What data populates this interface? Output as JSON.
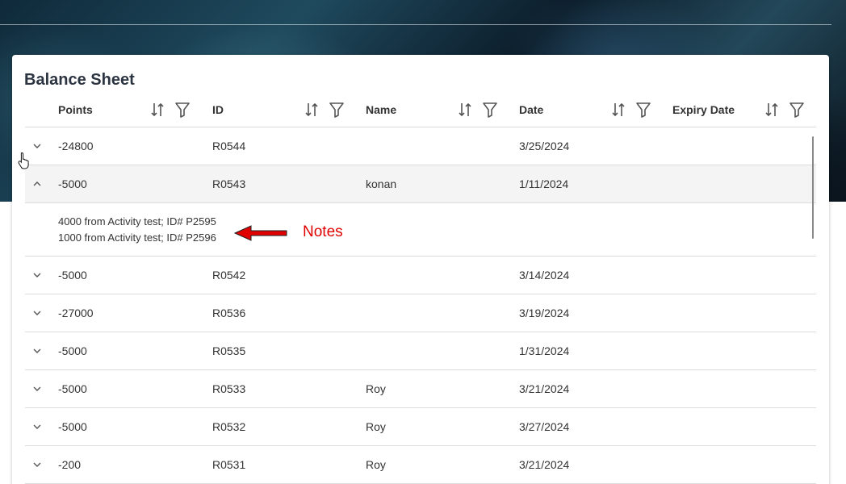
{
  "title": "Balance Sheet",
  "columns": [
    {
      "label": "Points"
    },
    {
      "label": "ID"
    },
    {
      "label": "Name"
    },
    {
      "label": "Date"
    },
    {
      "label": "Expiry Date"
    }
  ],
  "rows": [
    {
      "points": "-24800",
      "id": "R0544",
      "name": "",
      "date": "3/25/2024",
      "expiry": "",
      "expanded": false
    },
    {
      "points": "-5000",
      "id": "R0543",
      "name": "konan",
      "date": "1/11/2024",
      "expiry": "",
      "expanded": true,
      "notes": [
        "4000 from Activity test; ID# P2595",
        "1000 from Activity test; ID# P2596"
      ]
    },
    {
      "points": "-5000",
      "id": "R0542",
      "name": "",
      "date": "3/14/2024",
      "expiry": "",
      "expanded": false
    },
    {
      "points": "-27000",
      "id": "R0536",
      "name": "",
      "date": "3/19/2024",
      "expiry": "",
      "expanded": false
    },
    {
      "points": "-5000",
      "id": "R0535",
      "name": "",
      "date": "1/31/2024",
      "expiry": "",
      "expanded": false
    },
    {
      "points": "-5000",
      "id": "R0533",
      "name": "Roy",
      "date": "3/21/2024",
      "expiry": "",
      "expanded": false
    },
    {
      "points": "-5000",
      "id": "R0532",
      "name": "Roy",
      "date": "3/27/2024",
      "expiry": "",
      "expanded": false
    },
    {
      "points": "-200",
      "id": "R0531",
      "name": "Roy",
      "date": "3/21/2024",
      "expiry": "",
      "expanded": false
    }
  ],
  "annotation": {
    "label": "Notes",
    "color": "#e00000"
  },
  "icons": {
    "sort": "sort-icon",
    "filter": "filter-icon",
    "expand": "chevron-down-icon",
    "collapse": "chevron-up-icon",
    "cursor": "hand-pointer-icon"
  }
}
